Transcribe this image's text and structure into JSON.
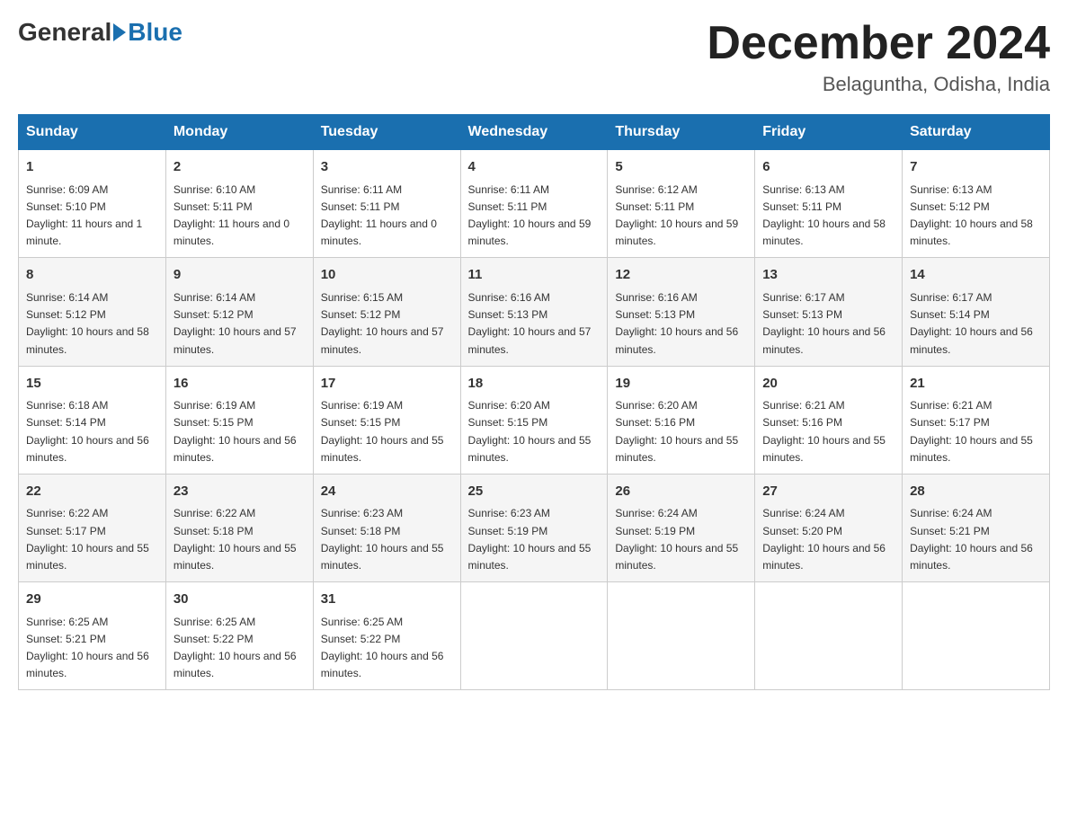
{
  "header": {
    "logo_general": "General",
    "logo_blue": "Blue",
    "month_title": "December 2024",
    "location": "Belaguntha, Odisha, India"
  },
  "days_of_week": [
    "Sunday",
    "Monday",
    "Tuesday",
    "Wednesday",
    "Thursday",
    "Friday",
    "Saturday"
  ],
  "weeks": [
    [
      {
        "day": "1",
        "sunrise": "6:09 AM",
        "sunset": "5:10 PM",
        "daylight": "11 hours and 1 minute."
      },
      {
        "day": "2",
        "sunrise": "6:10 AM",
        "sunset": "5:11 PM",
        "daylight": "11 hours and 0 minutes."
      },
      {
        "day": "3",
        "sunrise": "6:11 AM",
        "sunset": "5:11 PM",
        "daylight": "11 hours and 0 minutes."
      },
      {
        "day": "4",
        "sunrise": "6:11 AM",
        "sunset": "5:11 PM",
        "daylight": "10 hours and 59 minutes."
      },
      {
        "day": "5",
        "sunrise": "6:12 AM",
        "sunset": "5:11 PM",
        "daylight": "10 hours and 59 minutes."
      },
      {
        "day": "6",
        "sunrise": "6:13 AM",
        "sunset": "5:11 PM",
        "daylight": "10 hours and 58 minutes."
      },
      {
        "day": "7",
        "sunrise": "6:13 AM",
        "sunset": "5:12 PM",
        "daylight": "10 hours and 58 minutes."
      }
    ],
    [
      {
        "day": "8",
        "sunrise": "6:14 AM",
        "sunset": "5:12 PM",
        "daylight": "10 hours and 58 minutes."
      },
      {
        "day": "9",
        "sunrise": "6:14 AM",
        "sunset": "5:12 PM",
        "daylight": "10 hours and 57 minutes."
      },
      {
        "day": "10",
        "sunrise": "6:15 AM",
        "sunset": "5:12 PM",
        "daylight": "10 hours and 57 minutes."
      },
      {
        "day": "11",
        "sunrise": "6:16 AM",
        "sunset": "5:13 PM",
        "daylight": "10 hours and 57 minutes."
      },
      {
        "day": "12",
        "sunrise": "6:16 AM",
        "sunset": "5:13 PM",
        "daylight": "10 hours and 56 minutes."
      },
      {
        "day": "13",
        "sunrise": "6:17 AM",
        "sunset": "5:13 PM",
        "daylight": "10 hours and 56 minutes."
      },
      {
        "day": "14",
        "sunrise": "6:17 AM",
        "sunset": "5:14 PM",
        "daylight": "10 hours and 56 minutes."
      }
    ],
    [
      {
        "day": "15",
        "sunrise": "6:18 AM",
        "sunset": "5:14 PM",
        "daylight": "10 hours and 56 minutes."
      },
      {
        "day": "16",
        "sunrise": "6:19 AM",
        "sunset": "5:15 PM",
        "daylight": "10 hours and 56 minutes."
      },
      {
        "day": "17",
        "sunrise": "6:19 AM",
        "sunset": "5:15 PM",
        "daylight": "10 hours and 55 minutes."
      },
      {
        "day": "18",
        "sunrise": "6:20 AM",
        "sunset": "5:15 PM",
        "daylight": "10 hours and 55 minutes."
      },
      {
        "day": "19",
        "sunrise": "6:20 AM",
        "sunset": "5:16 PM",
        "daylight": "10 hours and 55 minutes."
      },
      {
        "day": "20",
        "sunrise": "6:21 AM",
        "sunset": "5:16 PM",
        "daylight": "10 hours and 55 minutes."
      },
      {
        "day": "21",
        "sunrise": "6:21 AM",
        "sunset": "5:17 PM",
        "daylight": "10 hours and 55 minutes."
      }
    ],
    [
      {
        "day": "22",
        "sunrise": "6:22 AM",
        "sunset": "5:17 PM",
        "daylight": "10 hours and 55 minutes."
      },
      {
        "day": "23",
        "sunrise": "6:22 AM",
        "sunset": "5:18 PM",
        "daylight": "10 hours and 55 minutes."
      },
      {
        "day": "24",
        "sunrise": "6:23 AM",
        "sunset": "5:18 PM",
        "daylight": "10 hours and 55 minutes."
      },
      {
        "day": "25",
        "sunrise": "6:23 AM",
        "sunset": "5:19 PM",
        "daylight": "10 hours and 55 minutes."
      },
      {
        "day": "26",
        "sunrise": "6:24 AM",
        "sunset": "5:19 PM",
        "daylight": "10 hours and 55 minutes."
      },
      {
        "day": "27",
        "sunrise": "6:24 AM",
        "sunset": "5:20 PM",
        "daylight": "10 hours and 56 minutes."
      },
      {
        "day": "28",
        "sunrise": "6:24 AM",
        "sunset": "5:21 PM",
        "daylight": "10 hours and 56 minutes."
      }
    ],
    [
      {
        "day": "29",
        "sunrise": "6:25 AM",
        "sunset": "5:21 PM",
        "daylight": "10 hours and 56 minutes."
      },
      {
        "day": "30",
        "sunrise": "6:25 AM",
        "sunset": "5:22 PM",
        "daylight": "10 hours and 56 minutes."
      },
      {
        "day": "31",
        "sunrise": "6:25 AM",
        "sunset": "5:22 PM",
        "daylight": "10 hours and 56 minutes."
      },
      null,
      null,
      null,
      null
    ]
  ]
}
